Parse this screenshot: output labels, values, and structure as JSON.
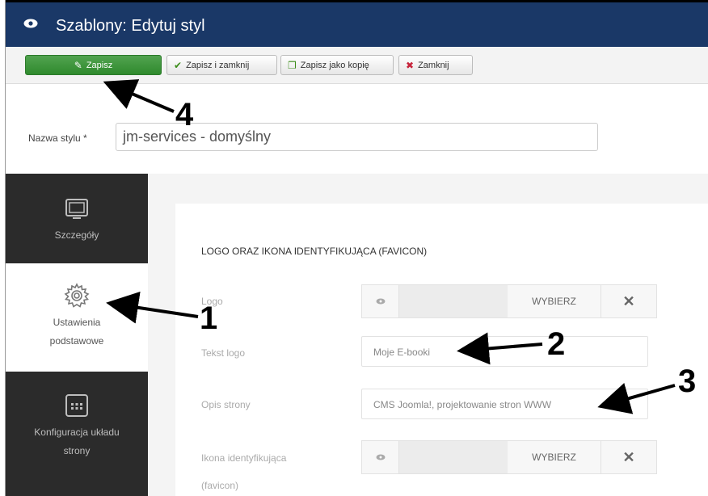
{
  "header": {
    "title": "Szablony: Edytuj styl",
    "icon": "eye-icon"
  },
  "toolbar": {
    "save_label": "Zapisz",
    "save_close_label": "Zapisz i zamknij",
    "save_copy_label": "Zapisz jako kopię",
    "close_label": "Zamknij"
  },
  "style_name": {
    "label": "Nazwa stylu *",
    "value": "jm-services - domyślny"
  },
  "sidebar": {
    "items": [
      {
        "label_lines": [
          "Szczegóły"
        ],
        "icon": "monitor-icon"
      },
      {
        "label_lines": [
          "Ustawienia",
          "podstawowe"
        ],
        "icon": "gear-icon",
        "active": true
      },
      {
        "label_lines": [
          "Konfiguracja układu",
          "strony"
        ],
        "icon": "layout-grid-icon"
      }
    ]
  },
  "section": {
    "title": "LOGO ORAZ IKONA IDENTYFIKUJĄCA (FAVICON)"
  },
  "fields": {
    "logo": {
      "label": "Logo",
      "select_label": "WYBIERZ",
      "clear_symbol": "✕"
    },
    "logo_text": {
      "label": "Tekst logo",
      "value": "Moje E-booki"
    },
    "site_description": {
      "label": "Opis strony",
      "value": "CMS Joomla!, projektowanie stron WWW"
    },
    "favicon": {
      "label_lines": [
        "Ikona identyfikująca",
        "(favicon)"
      ],
      "select_label": "WYBIERZ",
      "clear_symbol": "✕"
    }
  },
  "annotations": {
    "one": "1",
    "two": "2",
    "three": "3",
    "four": "4"
  },
  "colors": {
    "header_bg": "#1a3867",
    "save_green": "#3a963a",
    "sidebar_bg": "#2b2b2b"
  }
}
